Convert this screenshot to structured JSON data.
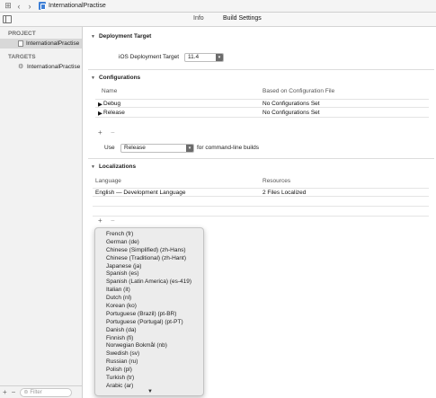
{
  "jumpbar": {
    "file_name": "InternationalPractise"
  },
  "tabs": {
    "info": "Info",
    "build_settings": "Build Settings"
  },
  "sidebar": {
    "project_header": "PROJECT",
    "project_item": "InternationalPractise",
    "targets_header": "TARGETS",
    "target_item": "InternationalPractise",
    "filter_placeholder": "Filter"
  },
  "deployment": {
    "title": "Deployment Target",
    "label": "iOS Deployment Target",
    "value": "11.4"
  },
  "configurations": {
    "title": "Configurations",
    "col_name": "Name",
    "col_based_on": "Based on Configuration File",
    "rows": [
      {
        "name": "Debug",
        "based_on": "No Configurations Set"
      },
      {
        "name": "Release",
        "based_on": "No Configurations Set"
      }
    ],
    "use_label": "Use",
    "use_value": "Release",
    "use_suffix": "for command-line builds"
  },
  "localizations": {
    "title": "Localizations",
    "col_language": "Language",
    "col_resources": "Resources",
    "rows": [
      {
        "language": "English — Development Language",
        "resources": "2 Files Localized"
      }
    ]
  },
  "language_menu": [
    "French (fr)",
    "German (de)",
    "Chinese (Simplified) (zh-Hans)",
    "Chinese (Traditional) (zh-Hant)",
    "Japanese (ja)",
    "Spanish (es)",
    "Spanish (Latin America) (es-419)",
    "Italian (it)",
    "Dutch (nl)",
    "Korean (ko)",
    "Portuguese (Brazil) (pt-BR)",
    "Portuguese (Portugal) (pt-PT)",
    "Danish (da)",
    "Finnish (fi)",
    "Norwegian Bokmål (nb)",
    "Swedish (sv)",
    "Russian (ru)",
    "Polish (pl)",
    "Turkish (tr)",
    "Arabic (ar)"
  ],
  "icons": {
    "grid": "grid-icon",
    "back": "chevron-left-icon",
    "forward": "chevron-right-icon",
    "panel": "sidebar-toggle-icon",
    "add": "plus-icon",
    "remove": "minus-icon",
    "filter": "filter-icon",
    "scroll_down": "triangle-down-icon"
  },
  "colors": {
    "project_icon": "#3d7fd6",
    "selected_row": "#d8d8d8"
  }
}
